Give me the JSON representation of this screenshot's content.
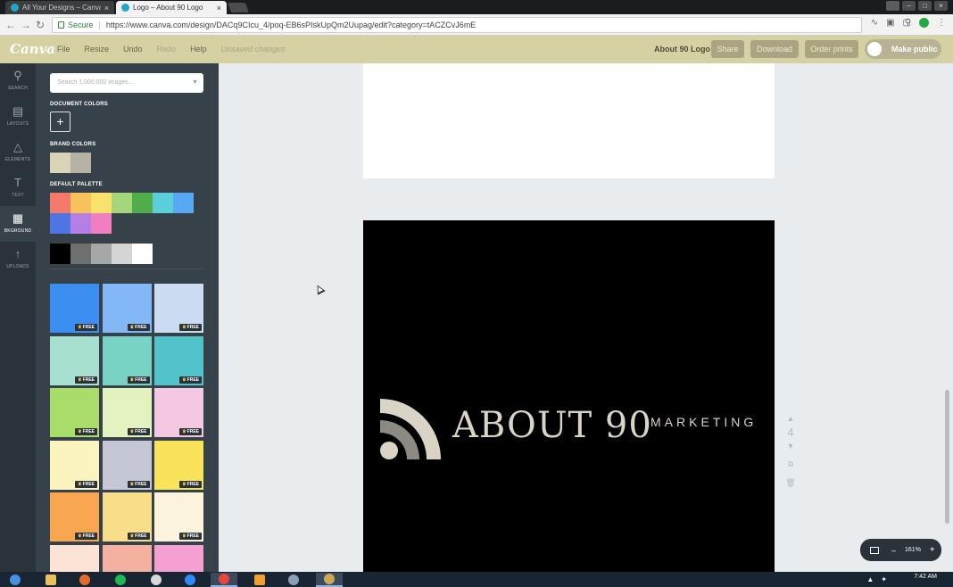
{
  "browser": {
    "tabs": [
      {
        "label": "All Your Designs – Canva",
        "active": false
      },
      {
        "label": "Logo – About 90 Logo",
        "active": true
      }
    ],
    "close_glyph": "×",
    "secure_label": "Secure",
    "url": "https://www.canva.com/design/DACq9CIcu_4/poq-EB6sPIskUpQm2Uupag/edit?category=tACZCvJ6mE",
    "nav": {
      "back": "←",
      "forward": "→",
      "reload": "↻"
    }
  },
  "topbar": {
    "brand": "Canva",
    "menu": {
      "file": "File",
      "resize": "Resize",
      "undo": "Undo",
      "redo": "Redo",
      "help": "Help",
      "status": "Unsaved changes"
    },
    "document_title": "About 90 Logo",
    "buttons": {
      "share": "Share",
      "download": "Download",
      "order_prints": "Order prints",
      "make_public": "Make public"
    }
  },
  "rail": [
    {
      "label": "SEARCH",
      "icon": "search-icon",
      "glyph": "⚲"
    },
    {
      "label": "LAYOUTS",
      "icon": "layouts-icon",
      "glyph": "▤"
    },
    {
      "label": "ELEMENTS",
      "icon": "elements-icon",
      "glyph": "△"
    },
    {
      "label": "TEXT",
      "icon": "text-icon",
      "glyph": "T"
    },
    {
      "label": "BKGROUND",
      "icon": "background-icon",
      "glyph": "▦"
    },
    {
      "label": "UPLOADS",
      "icon": "uploads-icon",
      "glyph": "↑"
    }
  ],
  "panel": {
    "search_placeholder": "Search 1,000,000 images...",
    "document_colors_label": "DOCUMENT COLORS",
    "add_color_glyph": "+",
    "brand_colors_label": "BRAND COLORS",
    "brand_colors": [
      "#d9d4b8",
      "#b5b2a5"
    ],
    "default_palette_label": "DEFAULT PALETTE",
    "palette_row1": [
      "#f47b6b",
      "#f7c15c",
      "#f9e36c",
      "#a6d57a",
      "#4fae4a",
      "#5ad0dd",
      "#57a9f3"
    ],
    "palette_row2": [
      "#4f74e3",
      "#b57fe6",
      "#f07ec1"
    ],
    "neutrals": [
      "#000000",
      "#6f6f6f",
      "#a7a7a7",
      "#d5d5d5",
      "#ffffff"
    ],
    "free_badge": "FREE",
    "tiles": [
      "#3b8ff0",
      "#82b8f5",
      "#cbdcf2",
      "#a7dfd0",
      "#78d3c4",
      "#52c3c8",
      "#a9dd6a",
      "#e4f2c0",
      "#f4c8e0",
      "#fbf4bf",
      "#c5c7d6",
      "#f9e35a",
      "#f8a650",
      "#f9de8a",
      "#fbf3dc",
      "#fbe3d6",
      "#f6b0a0",
      "#f59fd2"
    ]
  },
  "canvas": {
    "logo_name": "ABOUT 90",
    "logo_sub": "MARKETING",
    "page_number": "4",
    "logo_colors": {
      "arc_outer": "#d9d4c6",
      "arc_inner": "#8c8a82",
      "dot": "#d9d4c6"
    }
  },
  "zoom": {
    "value": "161%",
    "minus": "–",
    "plus": "+"
  },
  "taskbar": {
    "time": "7:42 AM"
  }
}
